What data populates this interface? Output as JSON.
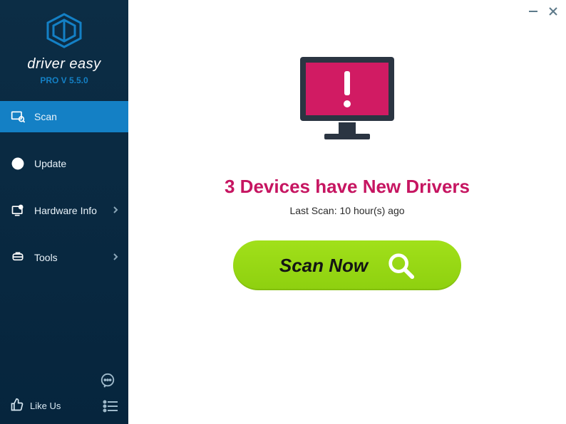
{
  "brand": {
    "name": "driver easy",
    "version_label": "PRO V 5.5.0"
  },
  "nav": {
    "scan": "Scan",
    "update": "Update",
    "hardware": "Hardware Info",
    "tools": "Tools"
  },
  "bottom": {
    "like_label": "Like Us"
  },
  "main": {
    "headline": "3 Devices have New Drivers",
    "last_scan": "Last Scan: 10 hour(s) ago",
    "scan_button": "Scan Now"
  },
  "colors": {
    "accent_pink": "#c61561",
    "accent_green": "#94d60f",
    "sidebar_bg": "#0a2b44",
    "active_blue": "#1480c5"
  }
}
